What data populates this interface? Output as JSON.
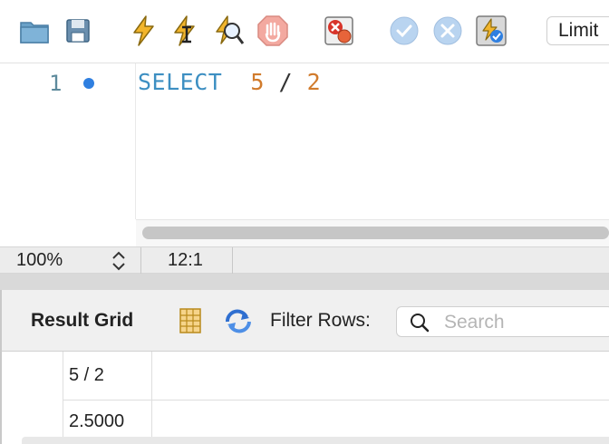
{
  "toolbar": {
    "buttons": [
      {
        "name": "open-file-icon",
        "label": "Open SQL script"
      },
      {
        "name": "save-icon",
        "label": "Save SQL script"
      },
      {
        "name": "execute-icon",
        "label": "Execute"
      },
      {
        "name": "execute-current-icon",
        "label": "Execute current statement"
      },
      {
        "name": "explain-icon",
        "label": "Explain"
      },
      {
        "name": "stop-icon",
        "label": "Stop"
      },
      {
        "name": "toggle-error-icon",
        "label": "Toggle stop on error"
      },
      {
        "name": "commit-icon",
        "label": "Commit"
      },
      {
        "name": "rollback-icon",
        "label": "Rollback"
      },
      {
        "name": "autocommit-icon",
        "label": "Toggle autocommit"
      }
    ],
    "limit_label": "Limit"
  },
  "editor": {
    "lines": [
      {
        "number": "1",
        "tokens": [
          {
            "text": "SELECT",
            "kind": "keyword"
          },
          {
            "text": "  ",
            "kind": "space"
          },
          {
            "text": "5",
            "kind": "number"
          },
          {
            "text": " / ",
            "kind": "operator"
          },
          {
            "text": "2",
            "kind": "number"
          }
        ]
      }
    ]
  },
  "status": {
    "zoom": "100%",
    "cursor": "12:1"
  },
  "results": {
    "label": "Result Grid",
    "filter_label": "Filter Rows:",
    "search_placeholder": "Search",
    "columns": [
      "5 / 2"
    ],
    "rows": [
      [
        "2.5000"
      ]
    ]
  },
  "colors": {
    "keyword": "#3d8fc2",
    "number": "#d17b2c",
    "line_number": "#5d8a9c",
    "bullet": "#2f7fe0"
  }
}
